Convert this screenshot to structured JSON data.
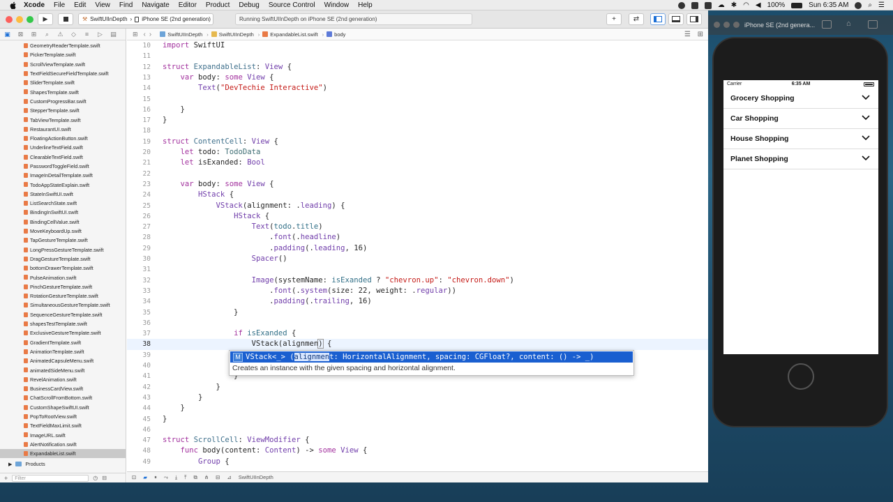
{
  "menubar": {
    "app": "Xcode",
    "items": [
      "File",
      "Edit",
      "View",
      "Find",
      "Navigate",
      "Editor",
      "Product",
      "Debug",
      "Source Control",
      "Window",
      "Help"
    ],
    "battery": "100%",
    "clock": "Sun 6:35 AM"
  },
  "toolbar": {
    "scheme_project": "SwiftUIInDepth",
    "scheme_device": "iPhone SE (2nd generation)",
    "activity": "Running SwiftUIInDepth on iPhone SE (2nd generation)",
    "add": "+"
  },
  "navigator": {
    "files": [
      "GeometryReaderTemplate.swift",
      "PickerTemplate.swift",
      "ScrollViewTemplate.swift",
      "TextFieldSecureFieldTemplate.swift",
      "SliderTemplate.swift",
      "ShapesTemplate.swift",
      "CustomProgressBar.swift",
      "StepperTemplate.swift",
      "TabViewTemplate.swift",
      "RestaurantUI.swift",
      "FloatingActionButton.swift",
      "UnderlineTextField.swift",
      "ClearableTextField.swift",
      "PasswordToggleField.swift",
      "ImageInDetailTemplate.swift",
      "TodoAppStateExplain.swift",
      "StateInSwiftUI.swift",
      "ListSearchState.swift",
      "BindingInSwiftUI.swift",
      "BindingCellValue.swift",
      "MoveKeyboardUp.swift",
      "TapGestureTemplate.swift",
      "LongPressGestureTemplate.swift",
      "DragGestureTemplate.swift",
      "bottomDrawerTemplate.swift",
      "PulseAnimation.swift",
      "PinchGestureTemplate.swift",
      "RotationGestureTemplate.swift",
      "SimultaneousGestureTemplate.swift",
      "SequenceGestureTemplate.swift",
      "shapesTestTemplate.swift",
      "ExclusiveGestureTemplate.swift",
      "GradientTemplate.swift",
      "AnimationTemplate.swift",
      "AnimatedCapsuleMenu.swift",
      "animatedSideMenu.swift",
      "RevelAnimation.swift",
      "BusinessCardView.swift",
      "ChatScrollFromBottom.swift",
      "CustomShapeSwiftUI.swift",
      "PopToRootView.swift",
      "TextFieldMaxLimit.swift",
      "ImageURL.swift",
      "AlertNotification.swift",
      "ExpandableList.swift"
    ],
    "selected_index": 44,
    "group": "Products",
    "filter_placeholder": "Filter"
  },
  "jumpbar": [
    "SwiftUIInDepth",
    "SwiftUIInDepth",
    "ExpandableList.swift",
    "body"
  ],
  "editor": {
    "current_line": 38,
    "lines": [
      {
        "n": "10",
        "html": "<span class='kw'>import</span> SwiftUI"
      },
      {
        "n": "11",
        "html": ""
      },
      {
        "n": "12",
        "html": "<span class='kw'>struct</span> <span class='ty'>ExpandableList</span>: <span class='ty2'>View</span> {"
      },
      {
        "n": "13",
        "html": "    <span class='kw'>var</span> body: <span class='kw'>some</span> <span class='ty2'>View</span> {"
      },
      {
        "n": "14",
        "html": "        <span class='ty2'>Text</span>(<span class='st'>\"DevTechie Interactive\"</span>)"
      },
      {
        "n": "15",
        "html": ""
      },
      {
        "n": "16",
        "html": "    }"
      },
      {
        "n": "17",
        "html": "}"
      },
      {
        "n": "18",
        "html": ""
      },
      {
        "n": "19",
        "html": "<span class='kw'>struct</span> <span class='ty'>ContentCell</span>: <span class='ty2'>View</span> {"
      },
      {
        "n": "20",
        "html": "    <span class='kw'>let</span> todo: <span class='er'>TodoData</span>"
      },
      {
        "n": "21",
        "html": "    <span class='kw'>let</span> isExanded: <span class='ty2'>Bool</span>"
      },
      {
        "n": "22",
        "html": ""
      },
      {
        "n": "23",
        "html": "    <span class='kw'>var</span> body: <span class='kw'>some</span> <span class='ty2'>View</span> {"
      },
      {
        "n": "24",
        "html": "        <span class='ty2'>HStack</span> {"
      },
      {
        "n": "25",
        "html": "            <span class='ty2'>VStack</span>(alignment: .<span class='ty2'>leading</span>) {"
      },
      {
        "n": "26",
        "html": "                <span class='ty2'>HStack</span> {"
      },
      {
        "n": "27",
        "html": "                    <span class='ty2'>Text</span>(<span class='fn'>todo</span>.<span class='fn'>title</span>)"
      },
      {
        "n": "28",
        "html": "                        .<span class='ty2'>font</span>(.<span class='ty2'>headline</span>)"
      },
      {
        "n": "29",
        "html": "                        .<span class='ty2'>padding</span>(.<span class='ty2'>leading</span>, 16)"
      },
      {
        "n": "30",
        "html": "                    <span class='ty2'>Spacer</span>()"
      },
      {
        "n": "31",
        "html": ""
      },
      {
        "n": "32",
        "html": "                    <span class='ty2'>Image</span>(systemName: <span class='fn'>isExanded</span> ? <span class='st'>\"chevron.up\"</span>: <span class='st'>\"chevron.down\"</span>)"
      },
      {
        "n": "33",
        "html": "                        .<span class='ty2'>font</span>(.<span class='ty2'>system</span>(size: 22, weight: .<span class='ty2'>regular</span>))"
      },
      {
        "n": "34",
        "html": "                        .<span class='ty2'>padding</span>(.<span class='ty2'>trailing</span>, 16)"
      },
      {
        "n": "35",
        "html": "                }"
      },
      {
        "n": "36",
        "html": ""
      },
      {
        "n": "37",
        "html": "                <span class='kw'>if</span> <span class='fn'>isExanded</span> {"
      },
      {
        "n": "38",
        "html": "                    VStack(alignmen<span class='bracketcur'>)</span> {"
      },
      {
        "n": "39",
        "html": ""
      },
      {
        "n": "40",
        "html": "                    }"
      },
      {
        "n": "41",
        "html": "                }"
      },
      {
        "n": "42",
        "html": "            }"
      },
      {
        "n": "43",
        "html": "        }"
      },
      {
        "n": "44",
        "html": "    }"
      },
      {
        "n": "45",
        "html": "}"
      },
      {
        "n": "46",
        "html": ""
      },
      {
        "n": "47",
        "html": "<span class='kw'>struct</span> <span class='ty'>ScrollCell</span>: <span class='ty2'>ViewModifier</span> {"
      },
      {
        "n": "48",
        "html": "    <span class='kw'>func</span> body(content: <span class='ty2'>Content</span>) -> <span class='kw'>some</span> <span class='ty2'>View</span> {"
      },
      {
        "n": "49",
        "html": "        <span class='ty2'>Group</span> {"
      }
    ]
  },
  "autocomplete": {
    "badge": "M",
    "pre": "VStack<_> (",
    "highlight": "alignmen",
    "post": "t: HorizontalAlignment, spacing: CGFloat?, content: () -> _)",
    "description": "Creates an instance with the given spacing and horizontal alignment."
  },
  "debugbar": {
    "target": "SwiftUIInDepth"
  },
  "simulator": {
    "title": "iPhone SE (2nd genera...",
    "carrier": "Carrier",
    "time": "6:35 AM",
    "rows": [
      "Grocery Shopping",
      "Car Shopping",
      "House Shopping",
      "Planet Shopping"
    ]
  }
}
